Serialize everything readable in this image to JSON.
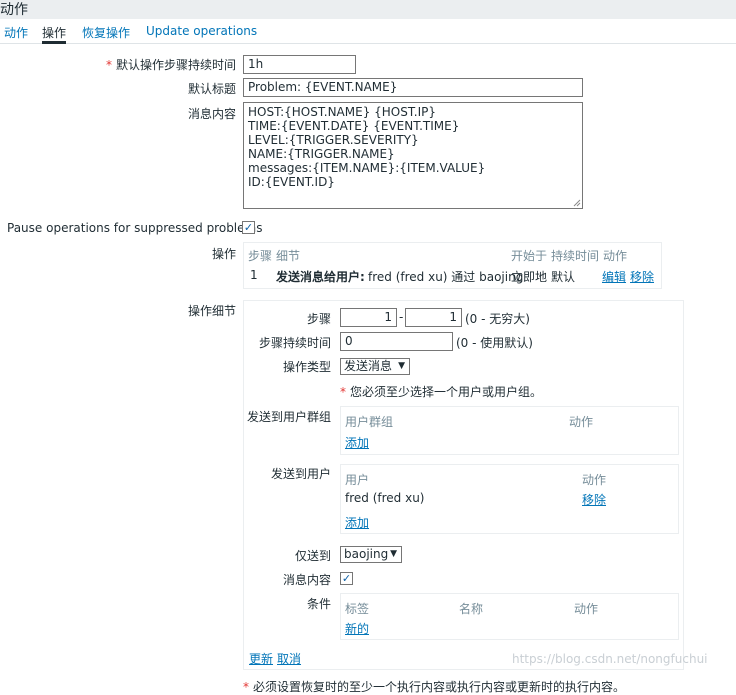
{
  "header": {
    "title": "动作"
  },
  "tabs": [
    {
      "label": "动作"
    },
    {
      "label": "操作"
    },
    {
      "label": "恢复操作"
    },
    {
      "label": "Update operations"
    }
  ],
  "form": {
    "default_step_duration": {
      "label": "默认操作步骤持续时间",
      "value": "1h"
    },
    "default_subject": {
      "label": "默认标题",
      "value": "Problem: {EVENT.NAME}"
    },
    "default_message": {
      "label": "消息内容",
      "lines": [
        "HOST:{HOST.NAME} {HOST.IP}",
        "TIME:{EVENT.DATE}  {EVENT.TIME}",
        "LEVEL:{TRIGGER.SEVERITY}",
        "NAME:{TRIGGER.NAME}",
        "messages:{ITEM.NAME}:{ITEM.VALUE}",
        "ID:{EVENT.ID}"
      ]
    },
    "pause_suppressed": {
      "label": "Pause operations for suppressed problems",
      "checked": true
    }
  },
  "operations": {
    "label": "操作",
    "headers": {
      "steps": "步骤",
      "details": "细节",
      "start_in": "开始于",
      "duration": "持续时间",
      "action": "动作"
    },
    "rows": [
      {
        "step": "1",
        "detail_bold": "发送消息给用户:",
        "detail_rest": "fred (fred xu) 通过 baojing",
        "start_in": "立即地",
        "duration": "默认",
        "edit": "编辑",
        "remove": "移除"
      }
    ]
  },
  "operation_details": {
    "label": "操作细节",
    "steps_label": "步骤",
    "step_from": "1",
    "step_to": "1",
    "step_hint": "(0 - 无穷大)",
    "step_duration_label": "步骤持续时间",
    "step_duration_value": "0",
    "step_duration_hint": "(0 - 使用默认)",
    "operation_type_label": "操作类型",
    "operation_type_value": "发送消息",
    "warning": "您必须至少选择一个用户或用户组。",
    "send_to_groups": {
      "label": "发送到用户群组",
      "col1": "用户群组",
      "col2": "动作",
      "add": "添加"
    },
    "send_to_users": {
      "label": "发送到用户",
      "col1": "用户",
      "col2": "动作",
      "rows": [
        {
          "name": "fred (fred xu)",
          "remove": "移除"
        }
      ],
      "add": "添加"
    },
    "send_only_to_label": "仅送到",
    "send_only_to_value": "baojing",
    "default_message_label": "消息内容",
    "default_message_checked": true,
    "conditions": {
      "label": "条件",
      "col1": "标签",
      "col2": "名称",
      "col3": "动作",
      "new": "新的"
    },
    "update": "更新",
    "cancel": "取消"
  },
  "footer": {
    "warning": "必须设置恢复时的至少一个执行内容或执行内容或更新时的执行内容。"
  },
  "watermark": "https://blog.csdn.net/nongfuchui"
}
